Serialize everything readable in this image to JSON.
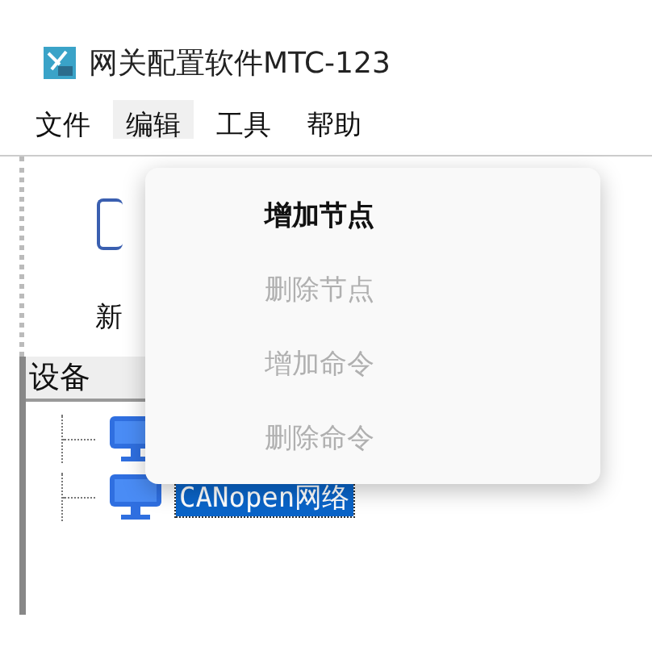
{
  "window": {
    "title": "网关配置软件MTC-123"
  },
  "menu_bar": [
    {
      "label": "文件",
      "selected": false
    },
    {
      "label": "编辑",
      "selected": true
    },
    {
      "label": "工具",
      "selected": false
    },
    {
      "label": "帮助",
      "selected": false
    }
  ],
  "toolbar": [
    {
      "label": "新"
    }
  ],
  "tree": {
    "header": "设备",
    "items": [
      {
        "kind": "covered"
      },
      {
        "kind": "labeled",
        "label": "CANopen网络",
        "selected": true
      }
    ]
  },
  "dropdown": [
    {
      "label": "增加节点",
      "disabled": false
    },
    {
      "label": "删除节点",
      "disabled": true
    },
    {
      "label": "增加命令",
      "disabled": true
    },
    {
      "label": "删除命令",
      "disabled": true
    }
  ]
}
